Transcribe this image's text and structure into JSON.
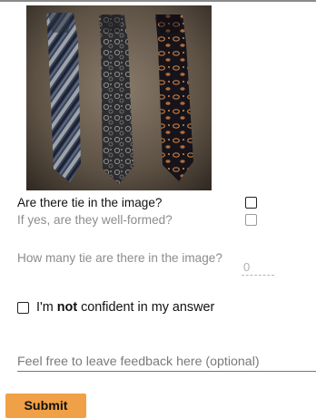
{
  "question_1": "Are there tie in the image?",
  "question_2": "If yes, are they well-formed?",
  "question_3": "How many tie are there in the image?",
  "count_placeholder": "0",
  "confidence": {
    "prefix": "I'm ",
    "emphasis": "not",
    "suffix": " confident in my answer"
  },
  "feedback_placeholder": "Feel free to leave feedback here (optional)",
  "submit_label": "Submit",
  "colors": {
    "submit_bg": "#f0a046",
    "muted_text": "#8c8c8c"
  }
}
